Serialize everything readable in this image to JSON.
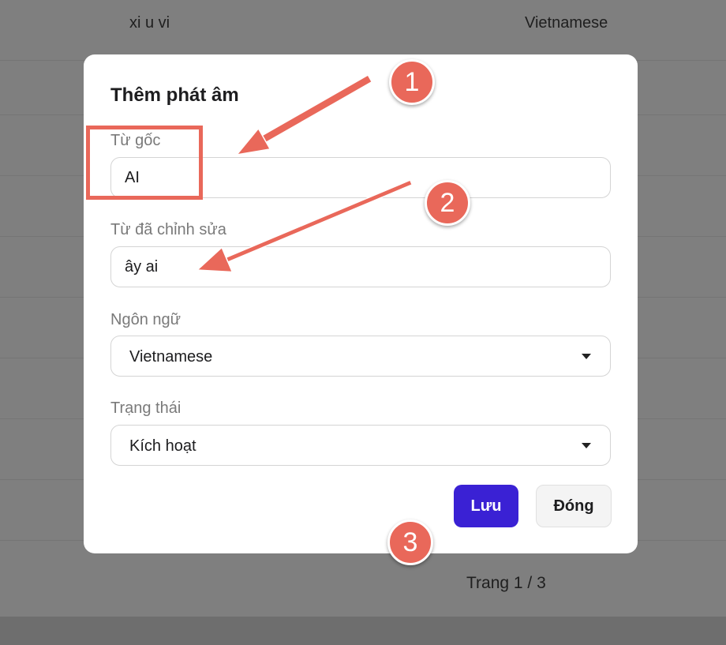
{
  "background_table": {
    "first_row": {
      "word": "xi u vi",
      "language": "Vietnamese"
    },
    "pagination": "Trang 1 / 3"
  },
  "dialog": {
    "title": "Thêm phát âm",
    "original_word": {
      "label": "Từ gốc",
      "value": "AI"
    },
    "edited_word": {
      "label": "Từ đã chỉnh sửa",
      "value": "ây ai"
    },
    "language": {
      "label": "Ngôn ngữ",
      "selected": "Vietnamese"
    },
    "status": {
      "label": "Trạng thái",
      "selected": "Kích hoạt"
    },
    "buttons": {
      "save": "Lưu",
      "close": "Đóng"
    }
  },
  "annotations": {
    "badges": [
      "1",
      "2",
      "3"
    ],
    "color": "#e9685a"
  },
  "colors": {
    "primary_button": "#3a21d4",
    "overlay": "#7f7f7f"
  }
}
